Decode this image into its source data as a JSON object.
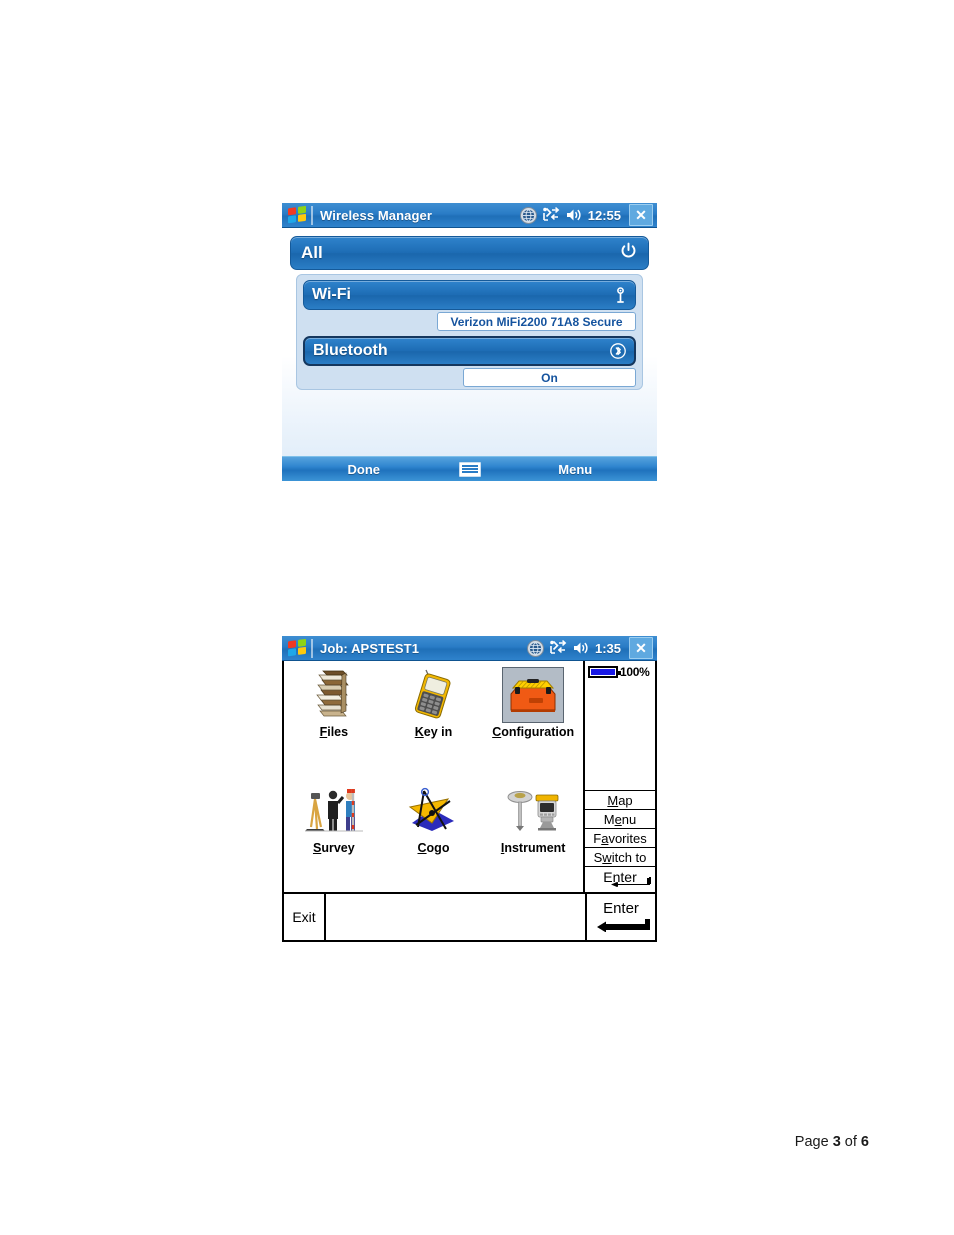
{
  "document": {
    "footer": {
      "prefix": "Page ",
      "current": "3",
      "middle": " of ",
      "total": "6"
    }
  },
  "wireless_manager": {
    "titlebar": {
      "start_icon": "windows-flag-icon",
      "title": "Wireless Manager",
      "tray_icons": [
        "globe-connection-icon",
        "connectivity-icon",
        "speaker-icon"
      ],
      "clock": "12:55",
      "close_label": "✕"
    },
    "all_row": {
      "label": "All",
      "icon": "power-icon"
    },
    "radios": [
      {
        "name": "Wi-Fi",
        "icon": "wifi-antenna-icon",
        "status": "Verizon MiFi2200 71A8 Secure",
        "focused": false
      },
      {
        "name": "Bluetooth",
        "icon": "bluetooth-icon",
        "status": "On",
        "focused": true
      }
    ],
    "softbar": {
      "left_label": "Done",
      "center_icon": "keyboard-icon",
      "right_label": "Menu"
    }
  },
  "survey_app": {
    "titlebar": {
      "start_icon": "windows-flag-icon",
      "title": "Job: APSTEST1",
      "tray_icons": [
        "globe-connection-icon",
        "connectivity-icon",
        "speaker-icon"
      ],
      "clock": "1:35",
      "close_label": "✕"
    },
    "battery": {
      "icon": "battery-full-icon",
      "percent": "100%"
    },
    "tiles": [
      {
        "label": "Files",
        "accel": "F",
        "rest": "iles",
        "icon": "stack-of-files-icon",
        "selected": false
      },
      {
        "label": "Key in",
        "accel": "K",
        "rest": "ey in",
        "icon": "data-collector-icon",
        "selected": false
      },
      {
        "label": "Configuration",
        "accel": "C",
        "rest": "onfiguration",
        "icon": "toolbox-icon",
        "selected": true
      },
      {
        "label": "Survey",
        "accel": "S",
        "rest": "urvey",
        "icon": "survey-crew-icon",
        "selected": false
      },
      {
        "label": "Cogo",
        "accel": "C",
        "rest": "ogo",
        "icon": "cogo-geometry-icon",
        "selected": false
      },
      {
        "label": "Instrument",
        "accel": "I",
        "rest": "nstrument",
        "icon": "total-station-icon",
        "selected": false
      }
    ],
    "sidebar_items": [
      {
        "label": "Map",
        "accel": "M",
        "pre": "M",
        "post": "ap"
      },
      {
        "label": "Menu",
        "accel": "e",
        "pre": "M",
        "post": "nu"
      },
      {
        "label": "Favorites",
        "accel": "a",
        "pre": "F",
        "post": "vorites"
      },
      {
        "label": "Switch to",
        "accel": "w",
        "pre": "S",
        "post": "itch to"
      }
    ],
    "sidebar_enter": {
      "label": "Enter",
      "icon": "return-arrow-icon"
    },
    "footer": {
      "exit_label": "Exit",
      "enter_label": "Enter",
      "enter_icon": "return-arrow-icon"
    }
  },
  "colors": {
    "titlebar_blue": "#2a7cc6",
    "panel_blue": "#1d6cb4",
    "group_bg": "#cfe0f1",
    "chip_text": "#15539e",
    "selection_gray": "#b3bcc6",
    "battery_fill": "#1818e6"
  }
}
